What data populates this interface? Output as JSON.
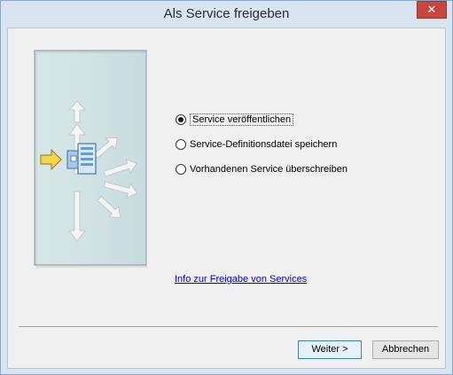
{
  "window": {
    "title": "Als Service freigeben",
    "close_glyph": "✕"
  },
  "options": [
    {
      "label": "Service veröffentlichen",
      "selected": true
    },
    {
      "label": "Service-Definitionsdatei speichern",
      "selected": false
    },
    {
      "label": "Vorhandenen Service überschreiben",
      "selected": false
    }
  ],
  "info_link": "Info zur Freigabe von Services",
  "buttons": {
    "next": "Weiter >",
    "cancel": "Abbrechen"
  },
  "illustration": {
    "icon": "publish-service-icon",
    "panel_color": "#cfe1e2",
    "arrow_color": "#f0f3f4",
    "input_arrow_color": "#f0d24a"
  }
}
